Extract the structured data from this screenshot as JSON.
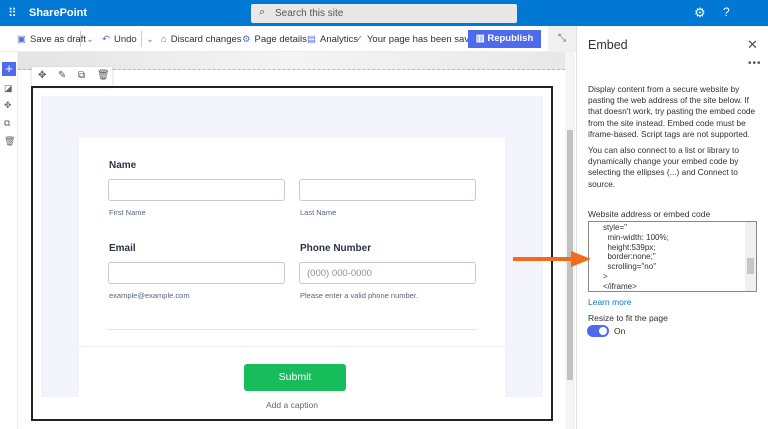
{
  "app": {
    "name": "SharePoint",
    "search_placeholder": "Search this site"
  },
  "toolbar": {
    "save_draft": "Save as draft",
    "undo": "Undo",
    "discard": "Discard changes",
    "page_details": "Page details",
    "analytics": "Analytics",
    "status": "Your page has been saved",
    "republish": "Republish"
  },
  "form": {
    "name_label": "Name",
    "first_name_sub": "First Name",
    "last_name_sub": "Last Name",
    "email_label": "Email",
    "email_sub": "example@example.com",
    "phone_label": "Phone Number",
    "phone_placeholder": "(000) 000-0000",
    "phone_sub": "Please enter a valid phone number.",
    "submit": "Submit"
  },
  "caption": "Add a caption",
  "panel": {
    "title": "Embed",
    "desc1": "Display content from a secure website by pasting the web address of the site below. If that doesn't work, try pasting the embed code from the site instead. Embed code must be iframe-based. Script tags are not supported.",
    "desc2": "You can also connect to a list or library to dynamically change your embed code by selecting the ellipses (...) and Connect to source.",
    "code_label": "Website address or embed code",
    "code": "style=\"\n  min-width: 100%;\n  height:539px;\n  border:none;\"\n  scrolling=\"no\"\n>\n</iframe>",
    "learn_more": "Learn more",
    "resize_label": "Resize to fit the page",
    "toggle_state": "On"
  },
  "colors": {
    "brand": "#0078d4",
    "accent": "#4f6bed",
    "submit": "#18bd5b",
    "arrow": "#f26b1d"
  }
}
